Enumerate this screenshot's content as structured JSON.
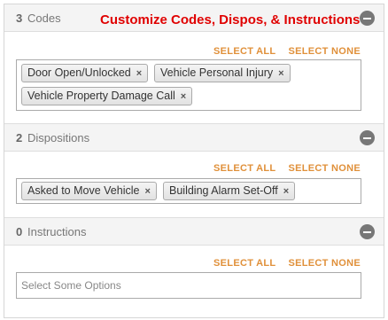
{
  "headline": "Customize Codes, Dispos, & Instructions",
  "actions": {
    "select_all": "SELECT ALL",
    "select_none": "SELECT NONE"
  },
  "sections": [
    {
      "count": "3",
      "label": "Codes",
      "chips": [
        "Door Open/Unlocked",
        "Vehicle Personal Injury",
        "Vehicle Property Damage Call"
      ]
    },
    {
      "count": "2",
      "label": "Dispositions",
      "chips": [
        "Asked to Move Vehicle",
        "Building Alarm Set-Off"
      ]
    },
    {
      "count": "0",
      "label": "Instructions",
      "placeholder": "Select Some Options"
    }
  ],
  "colors": {
    "headline": "#e00000",
    "actions": "#e0903a",
    "collapse_button": "#777777"
  }
}
